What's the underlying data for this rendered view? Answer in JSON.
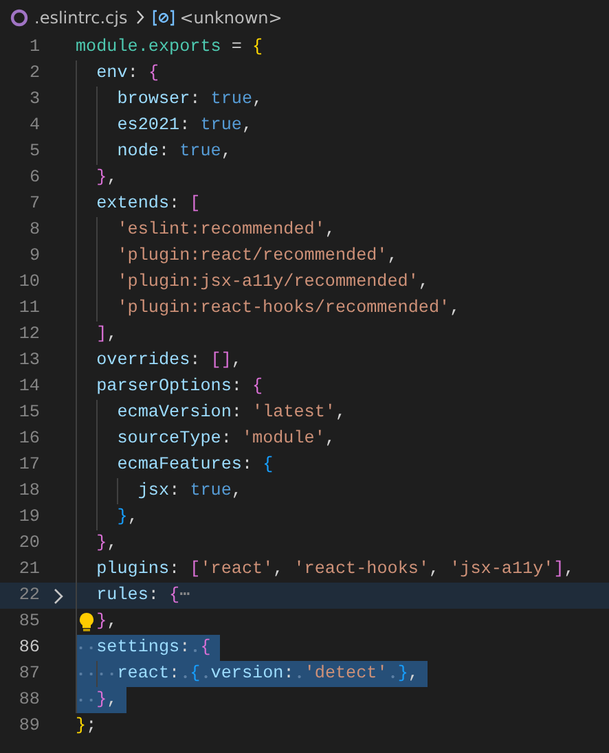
{
  "breadcrumb": {
    "file": ".eslintrc.cjs",
    "symbol": "<unknown>"
  },
  "lines": [
    {
      "number": "1",
      "text": "module.exports = {",
      "selected": false,
      "folded": false,
      "active": false,
      "lightbulb": false
    },
    {
      "number": "2",
      "text": "  env: {",
      "selected": false,
      "folded": false,
      "active": false,
      "lightbulb": false
    },
    {
      "number": "3",
      "text": "    browser: true,",
      "selected": false,
      "folded": false,
      "active": false,
      "lightbulb": false
    },
    {
      "number": "4",
      "text": "    es2021: true,",
      "selected": false,
      "folded": false,
      "active": false,
      "lightbulb": false
    },
    {
      "number": "5",
      "text": "    node: true,",
      "selected": false,
      "folded": false,
      "active": false,
      "lightbulb": false
    },
    {
      "number": "6",
      "text": "  },",
      "selected": false,
      "folded": false,
      "active": false,
      "lightbulb": false
    },
    {
      "number": "7",
      "text": "  extends: [",
      "selected": false,
      "folded": false,
      "active": false,
      "lightbulb": false
    },
    {
      "number": "8",
      "text": "    'eslint:recommended',",
      "selected": false,
      "folded": false,
      "active": false,
      "lightbulb": false
    },
    {
      "number": "9",
      "text": "    'plugin:react/recommended',",
      "selected": false,
      "folded": false,
      "active": false,
      "lightbulb": false
    },
    {
      "number": "10",
      "text": "    'plugin:jsx-a11y/recommended',",
      "selected": false,
      "folded": false,
      "active": false,
      "lightbulb": false
    },
    {
      "number": "11",
      "text": "    'plugin:react-hooks/recommended',",
      "selected": false,
      "folded": false,
      "active": false,
      "lightbulb": false
    },
    {
      "number": "12",
      "text": "  ],",
      "selected": false,
      "folded": false,
      "active": false,
      "lightbulb": false
    },
    {
      "number": "13",
      "text": "  overrides: [],",
      "selected": false,
      "folded": false,
      "active": false,
      "lightbulb": false
    },
    {
      "number": "14",
      "text": "  parserOptions: {",
      "selected": false,
      "folded": false,
      "active": false,
      "lightbulb": false
    },
    {
      "number": "15",
      "text": "    ecmaVersion: 'latest',",
      "selected": false,
      "folded": false,
      "active": false,
      "lightbulb": false
    },
    {
      "number": "16",
      "text": "    sourceType: 'module',",
      "selected": false,
      "folded": false,
      "active": false,
      "lightbulb": false
    },
    {
      "number": "17",
      "text": "    ecmaFeatures: {",
      "selected": false,
      "folded": false,
      "active": false,
      "lightbulb": false
    },
    {
      "number": "18",
      "text": "      jsx: true,",
      "selected": false,
      "folded": false,
      "active": false,
      "lightbulb": false
    },
    {
      "number": "19",
      "text": "    },",
      "selected": false,
      "folded": false,
      "active": false,
      "lightbulb": false
    },
    {
      "number": "20",
      "text": "  },",
      "selected": false,
      "folded": false,
      "active": false,
      "lightbulb": false
    },
    {
      "number": "21",
      "text": "  plugins: ['react', 'react-hooks', 'jsx-a11y'],",
      "selected": false,
      "folded": false,
      "active": false,
      "lightbulb": false
    },
    {
      "number": "22",
      "text": "  rules: {⋯",
      "selected": false,
      "folded": true,
      "active": false,
      "lightbulb": false
    },
    {
      "number": "85",
      "text": "  },",
      "selected": false,
      "folded": false,
      "active": false,
      "lightbulb": true
    },
    {
      "number": "86",
      "text": "  settings: {",
      "selected": true,
      "folded": false,
      "active": true,
      "lightbulb": false
    },
    {
      "number": "87",
      "text": "    react: { version: 'detect' },",
      "selected": true,
      "folded": false,
      "active": false,
      "lightbulb": false
    },
    {
      "number": "88",
      "text": "  },",
      "selected": true,
      "folded": false,
      "active": false,
      "lightbulb": false
    },
    {
      "number": "89",
      "text": "};",
      "selected": false,
      "folded": false,
      "active": false,
      "lightbulb": false
    }
  ]
}
